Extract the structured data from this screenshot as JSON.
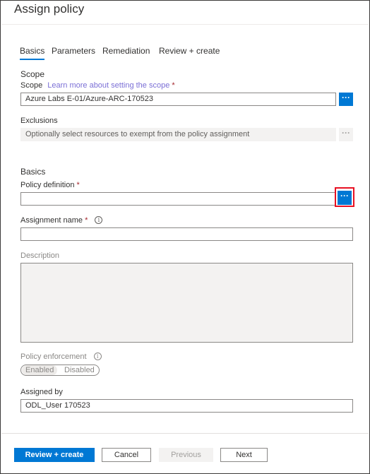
{
  "title": "Assign policy",
  "tabs": [
    {
      "label": "Basics"
    },
    {
      "label": "Parameters"
    },
    {
      "label": "Remediation"
    },
    {
      "label": "Review + create"
    }
  ],
  "scope": {
    "heading": "Scope",
    "label": "Scope",
    "link": "Learn more about setting the scope",
    "required": "*",
    "value": "Azure Labs E-01/Azure-ARC-170523",
    "browse": "···"
  },
  "exclusions": {
    "label": "Exclusions",
    "placeholder": "Optionally select resources to exempt from the policy assignment",
    "browse": "···"
  },
  "basics": {
    "heading": "Basics",
    "policy_definition_label": "Policy definition",
    "policy_definition_value": "",
    "required": "*",
    "browse": "···",
    "assignment_name_label": "Assignment name",
    "assignment_name_value": "",
    "info": "i",
    "description_label": "Description"
  },
  "enforcement": {
    "label": "Policy enforcement",
    "info": "i",
    "options": [
      "Enabled",
      "Disabled"
    ],
    "selected": "Enabled"
  },
  "assigned_by": {
    "label": "Assigned by",
    "value": "ODL_User 170523"
  },
  "footer": {
    "review_create": "Review + create",
    "cancel": "Cancel",
    "previous": "Previous",
    "next": "Next"
  },
  "colors": {
    "accent": "#0078d4",
    "required": "#a4262c",
    "highlight": "#e81123",
    "link": "#7b6fd6"
  }
}
